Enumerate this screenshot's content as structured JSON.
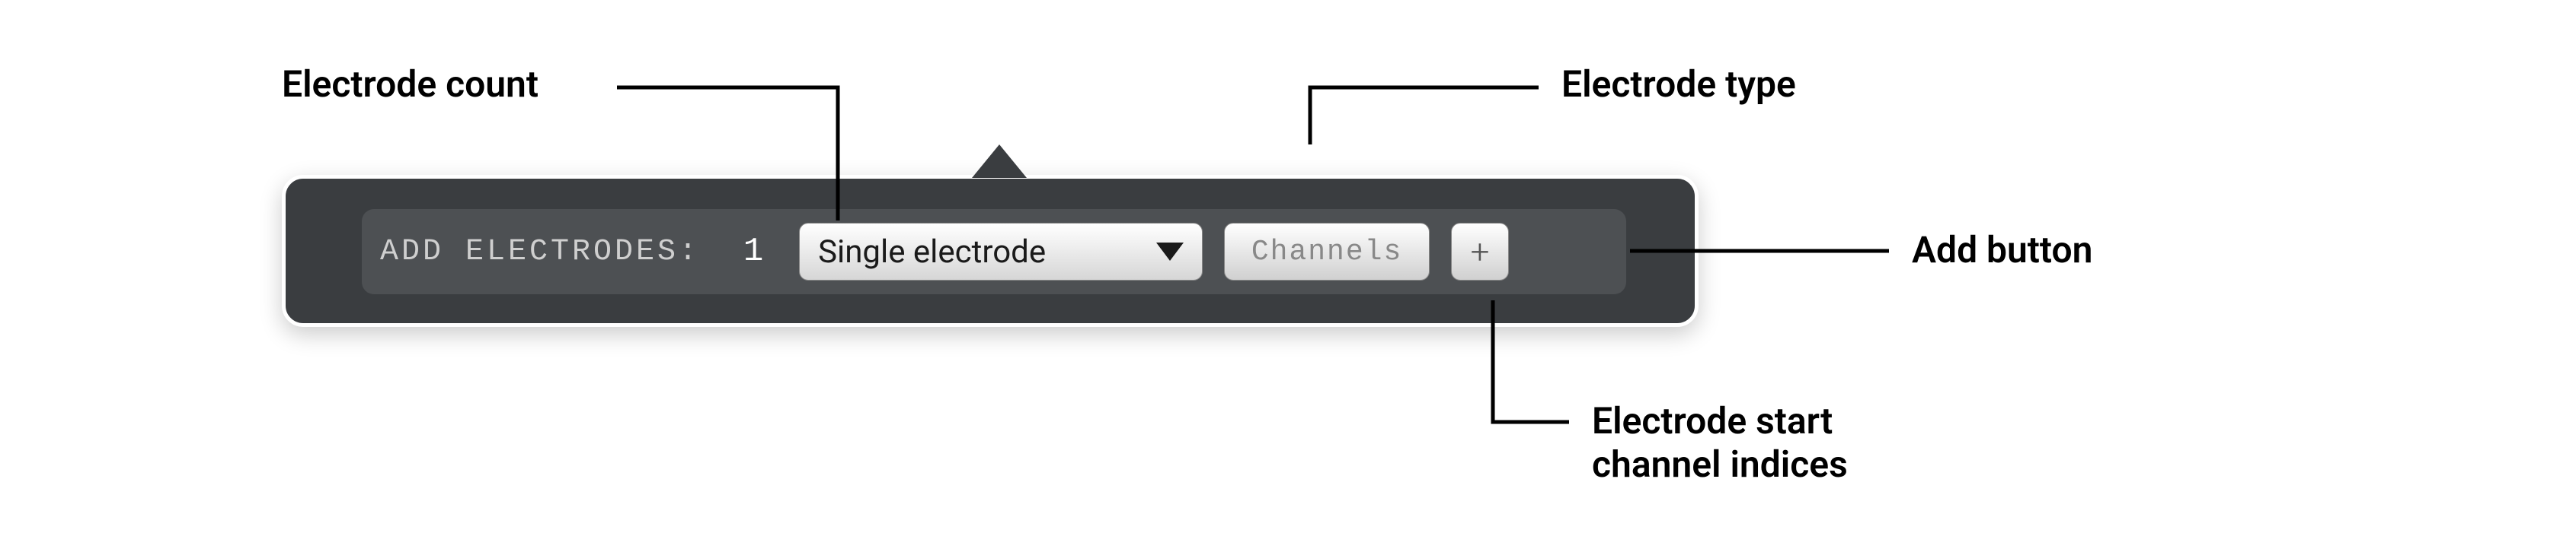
{
  "toolbar": {
    "label": "ADD ELECTRODES:",
    "count": "1",
    "type_selected": "Single electrode",
    "channels_placeholder": "Channels",
    "add_symbol": "+"
  },
  "callouts": {
    "electrode_count": "Electrode count",
    "electrode_type": "Electrode type",
    "add_button": "Add button",
    "start_indices": "Electrode start\nchannel indices"
  }
}
